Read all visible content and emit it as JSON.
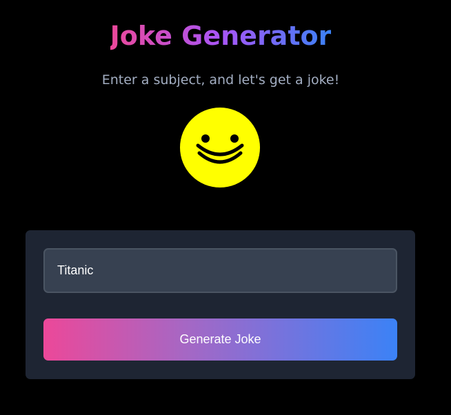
{
  "header": {
    "title": "Joke Generator",
    "subtitle": "Enter a subject, and let's get a joke!"
  },
  "mascot": {
    "icon": "smiley-face-icon",
    "face_color": "#ffff00",
    "feature_color": "#000000"
  },
  "form": {
    "subject_input": {
      "value": "Titanic",
      "placeholder": ""
    },
    "generate_label": "Generate Joke"
  },
  "colors": {
    "background": "#000000",
    "card": "#1e2533",
    "input_bg": "#374151",
    "gradient_start": "#ec4899",
    "gradient_mid": "#a855f7",
    "gradient_end": "#3b82f6",
    "subtitle": "#a3aec2"
  }
}
